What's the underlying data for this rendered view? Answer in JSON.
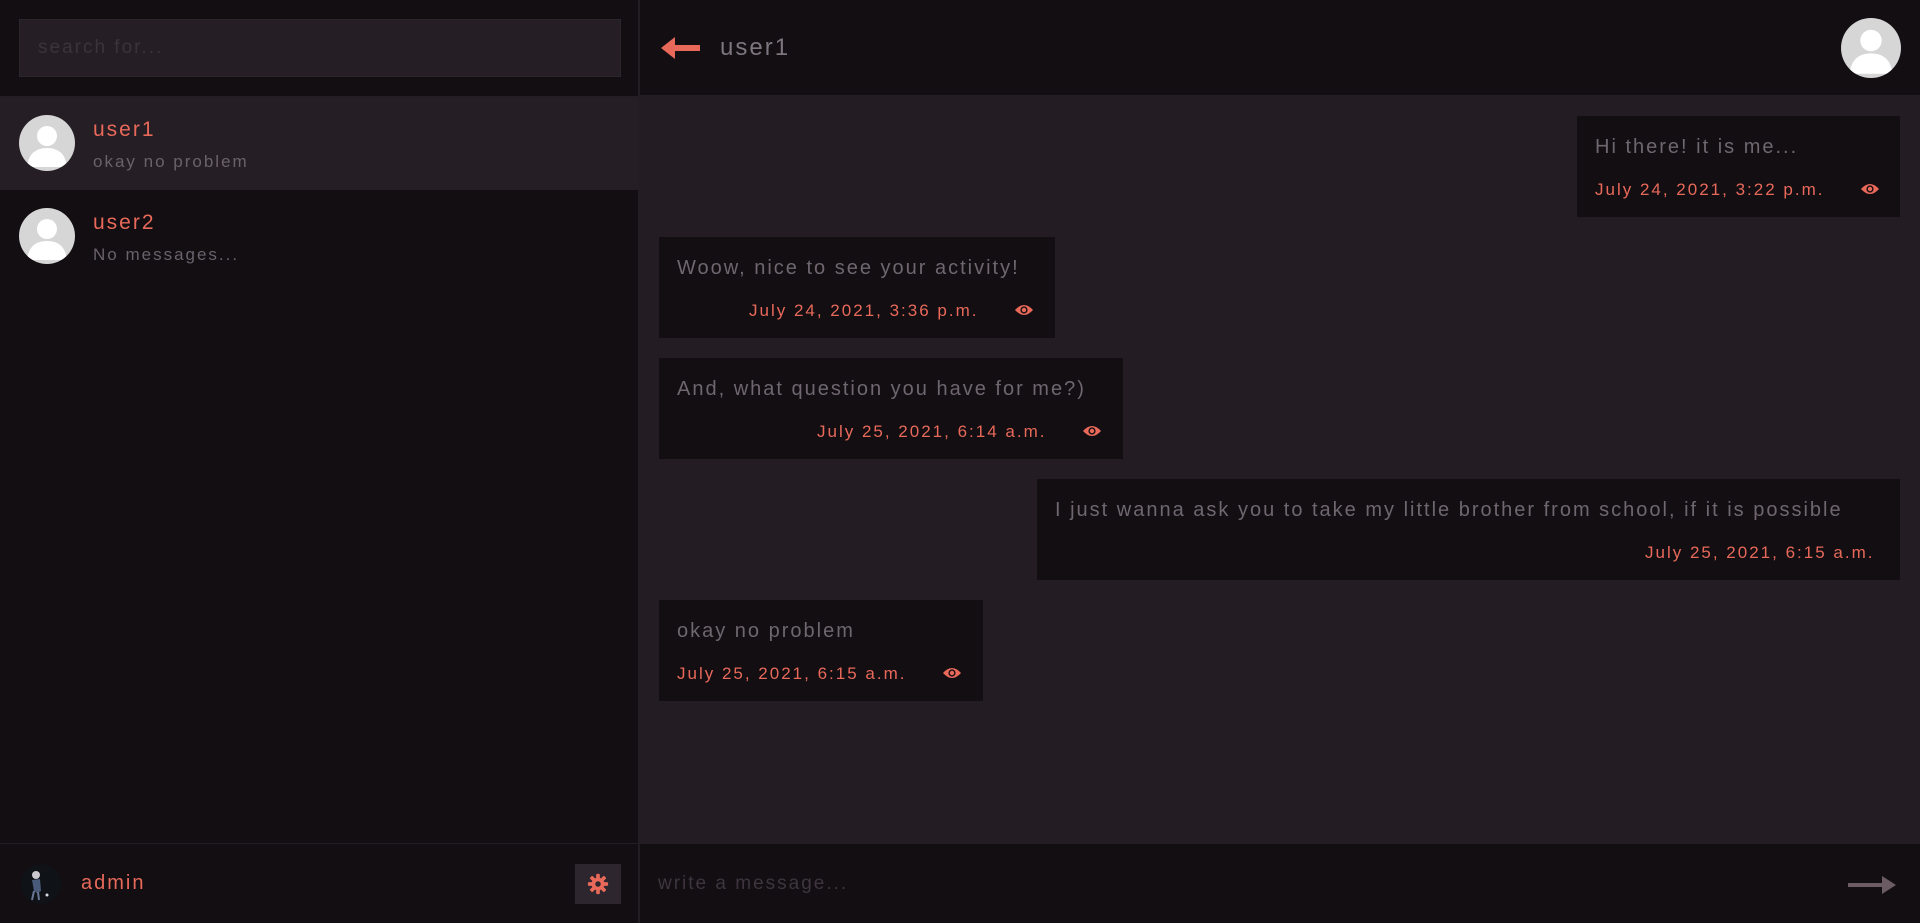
{
  "search": {
    "placeholder": "search for..."
  },
  "contacts": [
    {
      "name": "user1",
      "preview": "okay no problem",
      "active": true
    },
    {
      "name": "user2",
      "preview": "No messages...",
      "active": false
    }
  ],
  "current_user": {
    "name": "admin"
  },
  "chat": {
    "title": "user1",
    "messages": [
      {
        "text": "Hi there! it is me...",
        "time": "July 24, 2021, 3:22 p.m.",
        "side": "right",
        "seen_icon": true
      },
      {
        "text": "Woow, nice to see your activity!",
        "time": "July 24, 2021, 3:36 p.m.",
        "side": "left",
        "seen_icon": true
      },
      {
        "text": "And, what question you have for me?)",
        "time": "July 25, 2021, 6:14 a.m.",
        "side": "left",
        "seen_icon": true
      },
      {
        "text": "I just wanna ask you to take my little brother from school, if it is possible",
        "time": "July 25, 2021, 6:15 a.m.",
        "side": "right",
        "seen_icon": false
      },
      {
        "text": "okay no problem",
        "time": "July 25, 2021, 6:15 a.m.",
        "side": "left",
        "seen_icon": true
      }
    ],
    "input_placeholder": "write a message..."
  },
  "icons": {
    "back": "arrow-left-icon",
    "send": "arrow-right-icon",
    "settings": "gear-icon",
    "seen": "eye-icon",
    "avatar": "user-silhouette-icon"
  },
  "colors": {
    "accent": "#e8695a",
    "panel_dark": "#120e12",
    "panel_mid": "#231c23",
    "text_muted": "#6f666f"
  }
}
